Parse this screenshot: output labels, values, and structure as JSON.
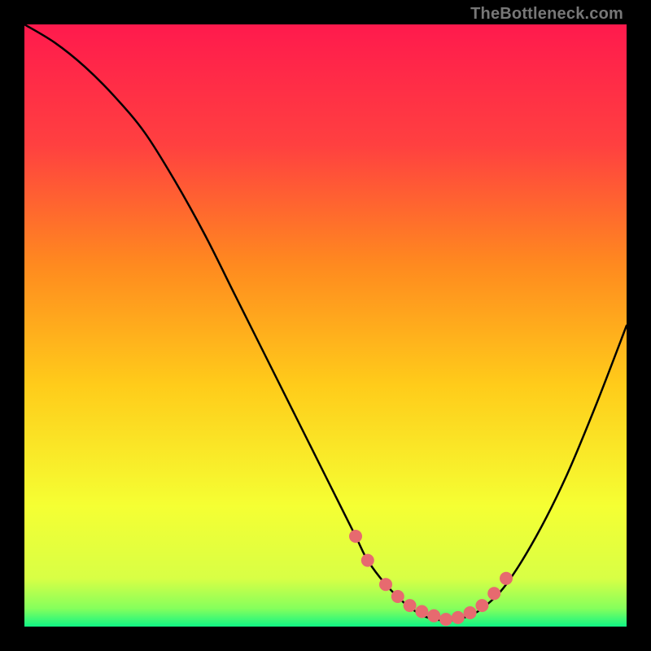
{
  "watermark": "TheBottleneck.com",
  "chart_data": {
    "type": "line",
    "title": "",
    "xlabel": "",
    "ylabel": "",
    "xlim": [
      0,
      100
    ],
    "ylim": [
      0,
      100
    ],
    "series": [
      {
        "name": "curve",
        "x": [
          0,
          5,
          10,
          15,
          20,
          25,
          30,
          35,
          40,
          45,
          50,
          55,
          57,
          60,
          63,
          65,
          67,
          70,
          73,
          76,
          80,
          85,
          90,
          95,
          100
        ],
        "y": [
          100,
          97,
          93,
          88,
          82,
          74,
          65,
          55,
          45,
          35,
          25,
          15,
          11,
          7,
          4,
          2.5,
          1.5,
          1,
          1.5,
          3,
          7,
          15,
          25,
          37,
          50
        ]
      }
    ],
    "markers": {
      "name": "dots",
      "x": [
        55,
        57,
        60,
        62,
        64,
        66,
        68,
        70,
        72,
        74,
        76,
        78,
        80
      ],
      "y": [
        15,
        11,
        7,
        5,
        3.5,
        2.5,
        1.8,
        1.2,
        1.5,
        2.3,
        3.5,
        5.5,
        8
      ]
    },
    "gradient_stops": [
      {
        "offset": 0.0,
        "color": "#ff1a4d"
      },
      {
        "offset": 0.2,
        "color": "#ff4040"
      },
      {
        "offset": 0.4,
        "color": "#ff8a1f"
      },
      {
        "offset": 0.6,
        "color": "#ffcc1a"
      },
      {
        "offset": 0.8,
        "color": "#f5ff33"
      },
      {
        "offset": 0.92,
        "color": "#d8ff45"
      },
      {
        "offset": 0.97,
        "color": "#85ff5c"
      },
      {
        "offset": 1.0,
        "color": "#10f585"
      }
    ]
  }
}
